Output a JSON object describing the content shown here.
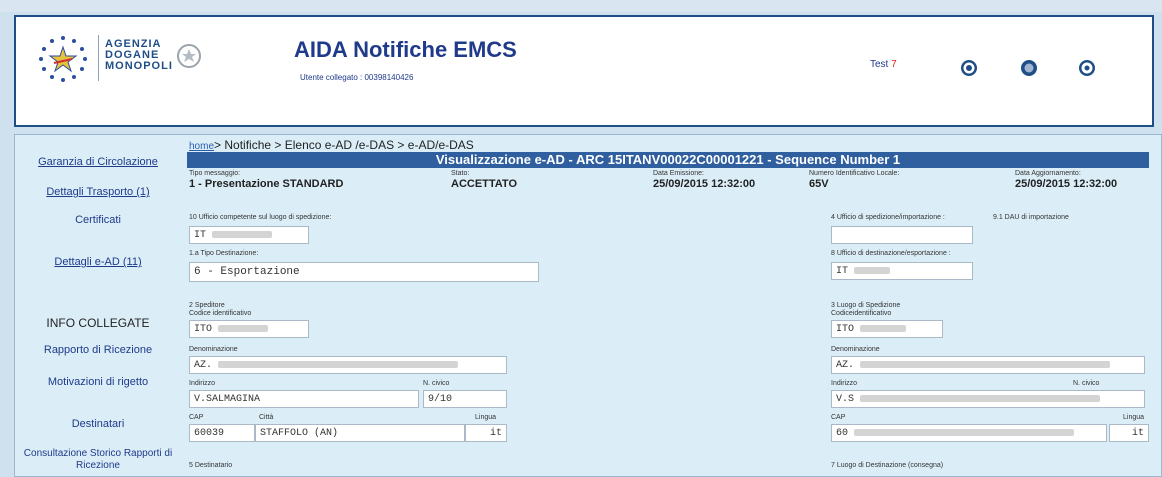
{
  "header": {
    "agency_lines": [
      "AGENZIA",
      "DOGANE",
      "MONOPOLI"
    ],
    "title": "AIDA Notifiche EMCS",
    "user_label": "Utente collegato : 00398140426",
    "test_label": "Test",
    "test_value": "7",
    "icons": [
      "home-icon",
      "settings-icon",
      "help-icon"
    ]
  },
  "sidebar": {
    "items": [
      {
        "label": "Garanzia di Circolazione"
      },
      {
        "label": "Dettagli Trasporto (1)"
      },
      {
        "label": "Certificati"
      },
      {
        "label": "Dettagli e-AD (11)"
      },
      {
        "label": "INFO COLLEGATE"
      },
      {
        "label": "Rapporto di Ricezione"
      },
      {
        "label": "Motivazioni di rigetto"
      },
      {
        "label": "Destinatari"
      },
      {
        "label": "Consultazione Storico Rapporti di Ricezione"
      }
    ]
  },
  "breadcrumb": {
    "home": "home",
    "rest": "> Notifiche > Elenco e-AD /e-DAS > e-AD/e-DAS"
  },
  "title_bar": "Visualizzazione e-AD - ARC 15ITANV00022C00001221 - Sequence Number 1",
  "summary": {
    "tipo_label": "Tipo messaggio:",
    "tipo_value": "1 - Presentazione STANDARD",
    "stato_label": "Stato:",
    "stato_value": "ACCETTATO",
    "emissione_label": "Data Emissione:",
    "emissione_value": "25/09/2015 12:32:00",
    "numero_label": "Numero Identificativo Locale:",
    "numero_value": "65V",
    "aggiornamento_label": "Data Aggiornamento:",
    "aggiornamento_value": "25/09/2015 12:32:00"
  },
  "form": {
    "ufficio_label": "10 Ufficio competente sul luogo di spedizione:",
    "ufficio_value": "IT",
    "tipo_dest_label": "1.a Tipo Destinazione:",
    "tipo_dest_value": "6 - Esportazione",
    "ufficio_sped_label": "4 Ufficio di spedizione/importazione :",
    "dau_label": "9.1 DAU di importazione",
    "ufficio_dest_label": "8 Ufficio di destinazione/esportazione :",
    "ufficio_dest_value": "IT",
    "speditore": {
      "section": "2 Speditore",
      "codice_label": "Codice identificativo",
      "codice_value": "ITO",
      "denominazione_label": "Denominazione",
      "denominazione_value": "AZ.",
      "indirizzo_label": "Indirizzo",
      "indirizzo_value": "V.SALMAGINA",
      "civico_label": "N. civico",
      "civico_value": "9/10",
      "cap_label": "CAP",
      "cap_value": "60039",
      "citta_label": "Città",
      "citta_value": "STAFFOLO (AN)",
      "lingua_label": "Lingua",
      "lingua_value": "it"
    },
    "luogo": {
      "section": "3 Luogo di Spedizione",
      "codice_label": "Codiceidentificativo",
      "codice_value": "ITO",
      "denominazione_label": "Denominazione",
      "denominazione_value": "AZ.",
      "indirizzo_label": "Indirizzo",
      "indirizzo_value": "V.S",
      "civico_label": "N. civico",
      "cap_label": "CAP",
      "cap_value": "60",
      "lingua_label": "Lingua",
      "lingua_value": "it"
    },
    "destinatario_label": "5 Destinatario",
    "luogo_dest_label": "7 Luogo di Destinazione (consegna)"
  }
}
